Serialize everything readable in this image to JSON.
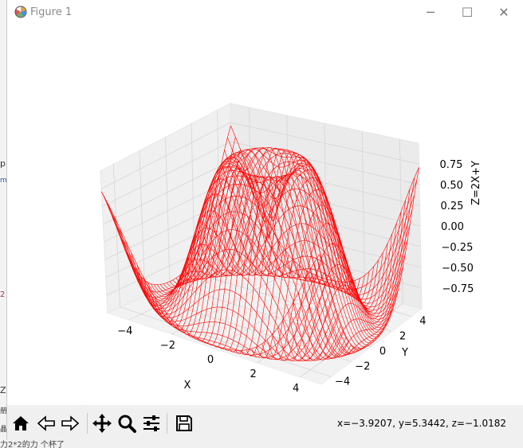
{
  "window": {
    "title": "Figure 1",
    "controls": {
      "minimize": "─",
      "maximize": "☐",
      "close": "✕"
    }
  },
  "background_app": {
    "fragments": [
      "p",
      "mp",
      "2",
      "Z",
      "册",
      "晶",
      "力2*2的力 个杯了"
    ]
  },
  "toolbar": {
    "buttons": [
      "home-icon",
      "back-icon",
      "forward-icon",
      "pan-icon",
      "zoom-icon",
      "configure-subplots-icon",
      "save-icon"
    ],
    "status_text": "x=−3.9207, y=5.3442, z=−1.0182"
  },
  "chart_data": {
    "type": "wireframe-3d",
    "surface": "z = sin(sqrt(x^2 + y^2))",
    "x_range": [
      -5,
      5
    ],
    "y_range": [
      -5,
      5
    ],
    "z_range": [
      -1,
      1
    ],
    "color": "#ff0000",
    "grid": true,
    "xlabel": "X",
    "ylabel": "Y",
    "zlabel": "Z=2X+Y",
    "x_ticks": [
      "−4",
      "−2",
      "0",
      "2",
      "4"
    ],
    "y_ticks": [
      "−4",
      "−2",
      "0",
      "2",
      "4"
    ],
    "z_ticks": [
      "0.75",
      "0.50",
      "0.25",
      "0.00",
      "−0.25",
      "−0.50",
      "−0.75"
    ]
  }
}
